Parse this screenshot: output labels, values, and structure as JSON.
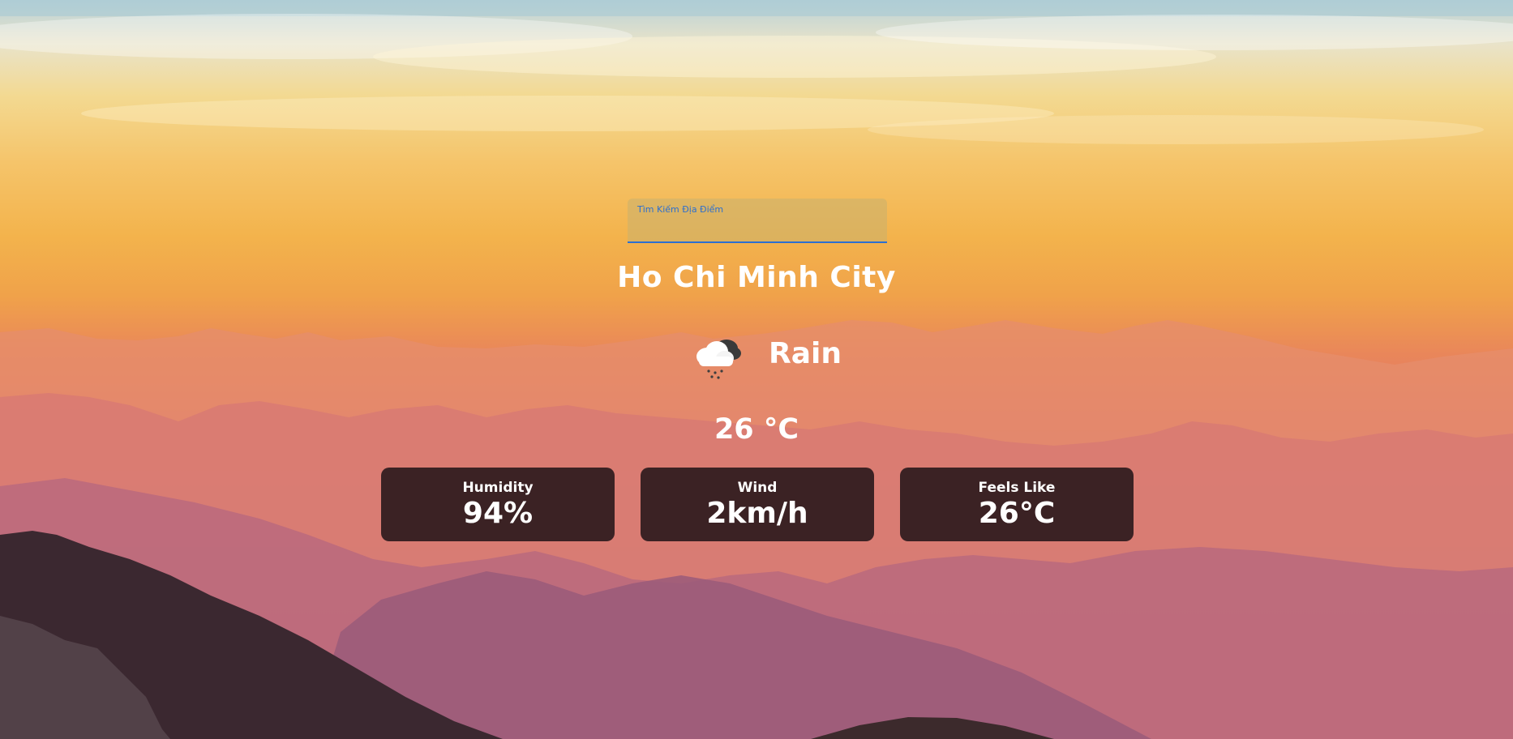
{
  "search": {
    "label": "Tìm Kiếm Địa Điểm",
    "value": ""
  },
  "location": {
    "city": "Ho Chi Minh City"
  },
  "weather": {
    "icon": "rain-cloud-icon",
    "condition": "Rain",
    "temperature": "26 °C"
  },
  "stats": [
    {
      "label": "Humidity",
      "value": "94%"
    },
    {
      "label": "Wind",
      "value": "2km/h"
    },
    {
      "label": "Feels Like",
      "value": "26°C"
    }
  ],
  "colors": {
    "search_underline": "#2d6fd0",
    "card_background": "#241619",
    "text": "#ffffff"
  }
}
